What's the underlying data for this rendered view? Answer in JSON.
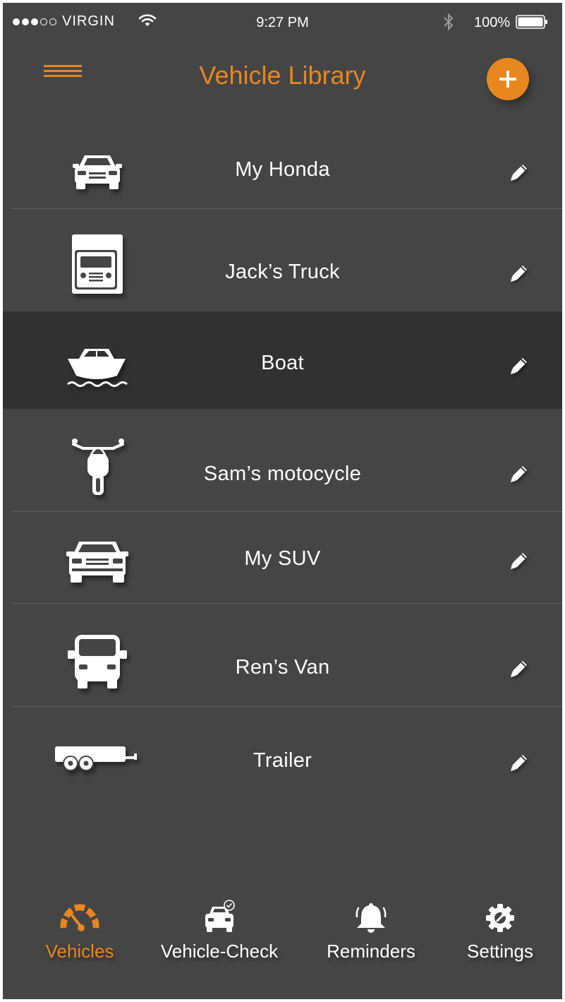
{
  "status_bar": {
    "carrier": "VIRGIN",
    "signal_bars": 3,
    "signal_max": 5,
    "time": "9:27 PM",
    "battery": "100%",
    "icons": [
      "wifi-icon",
      "bluetooth-icon",
      "battery-icon"
    ]
  },
  "header": {
    "title": "Vehicle Library",
    "menu_icon": "menu-icon",
    "add_icon": "plus-icon"
  },
  "vehicles": [
    {
      "name": "My Honda",
      "icon": "car-icon"
    },
    {
      "name": "Jack’s Truck",
      "icon": "truck-icon"
    },
    {
      "name": "Boat",
      "icon": "boat-icon"
    },
    {
      "name": "Sam’s motocycle",
      "icon": "motorcycle-icon"
    },
    {
      "name": "My SUV",
      "icon": "suv-icon"
    },
    {
      "name": "Ren’s Van",
      "icon": "van-icon"
    },
    {
      "name": "Trailer",
      "icon": "trailer-icon"
    }
  ],
  "selected_vehicle": "Boat",
  "edit_icon": "pencil-icon",
  "tabs": [
    {
      "label": "Vehicles",
      "icon": "speedometer-icon",
      "active": true
    },
    {
      "label": "Vehicle-Check",
      "icon": "car-check-icon",
      "active": false
    },
    {
      "label": "Reminders",
      "icon": "bell-icon",
      "active": false
    },
    {
      "label": "Settings",
      "icon": "gear-icon",
      "active": false
    }
  ],
  "colors": {
    "accent": "#e8871e",
    "background": "#454545",
    "selected_row": "#313131",
    "text": "#ffffff"
  }
}
